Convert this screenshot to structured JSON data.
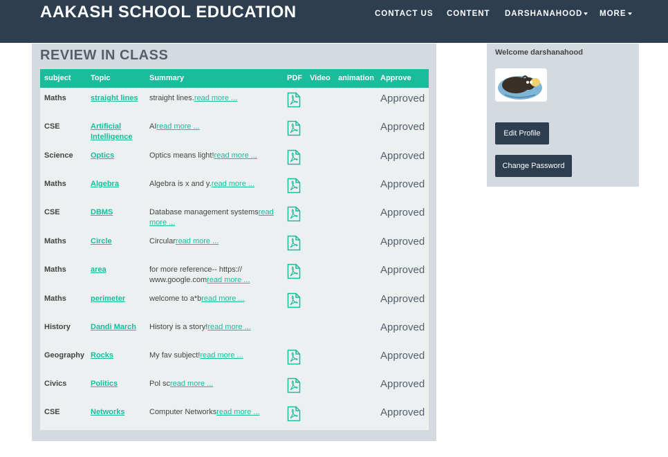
{
  "header": {
    "brand": "AAKASH SCHOOL EDUCATION",
    "nav": {
      "contact": "CONTACT US",
      "content": "CONTENT",
      "user": "DARSHANAHOOD",
      "more": "MORE"
    },
    "colors": {
      "navbar": "#2c3e50",
      "accent": "#1abc9c"
    }
  },
  "main": {
    "title": "REVIEW IN CLASS",
    "columns": {
      "subject": "subject",
      "topic": "Topic",
      "summary": "Summary",
      "pdf": "PDF",
      "video": "Video",
      "animation": "animation",
      "approve": "Approve"
    },
    "read_more_label": "read more ...",
    "rows": [
      {
        "subject": "Maths",
        "topic": "straight lines",
        "summary": "straight lines.",
        "pdf": true,
        "status": "Approved"
      },
      {
        "subject": "CSE",
        "topic": "Artificial Intelligence",
        "summary": "AI",
        "pdf": true,
        "status": "Approved"
      },
      {
        "subject": "Science",
        "topic": "Optics",
        "summary": "Optics means light!",
        "pdf": true,
        "status": "Approved"
      },
      {
        "subject": "Maths",
        "topic": "Algebra",
        "summary": "Algebra is x and y.",
        "pdf": true,
        "status": "Approved"
      },
      {
        "subject": "CSE",
        "topic": "DBMS",
        "summary": "Database management systems",
        "pdf": true,
        "status": "Approved"
      },
      {
        "subject": "Maths",
        "topic": "Circle",
        "summary": "Circular",
        "pdf": true,
        "status": "Approved"
      },
      {
        "subject": "Maths",
        "topic": "area",
        "summary": "for more reference-- https:// www.google.com",
        "pdf": true,
        "status": "Approved"
      },
      {
        "subject": "Maths",
        "topic": "perimeter",
        "summary": "welcome to a*b",
        "pdf": true,
        "status": "Approved"
      },
      {
        "subject": "History",
        "topic": "Dandi March",
        "summary": "History is a story!",
        "pdf": false,
        "status": "Approved"
      },
      {
        "subject": "Geography",
        "topic": "Rocks",
        "summary": "My fav subject!",
        "pdf": true,
        "status": "Approved"
      },
      {
        "subject": "Civics",
        "topic": "Politics",
        "summary": "Pol sc",
        "pdf": true,
        "status": "Approved"
      },
      {
        "subject": "CSE",
        "topic": "Networks",
        "summary": "Computer Networks",
        "pdf": true,
        "status": "Approved"
      }
    ],
    "pdf_icon": "pdf-file-icon"
  },
  "sidebar": {
    "welcome": "Welcome darshanahood",
    "avatar_icon": "profile-avatar-image",
    "edit_profile": "Edit Profile",
    "change_password": "Change Password"
  }
}
